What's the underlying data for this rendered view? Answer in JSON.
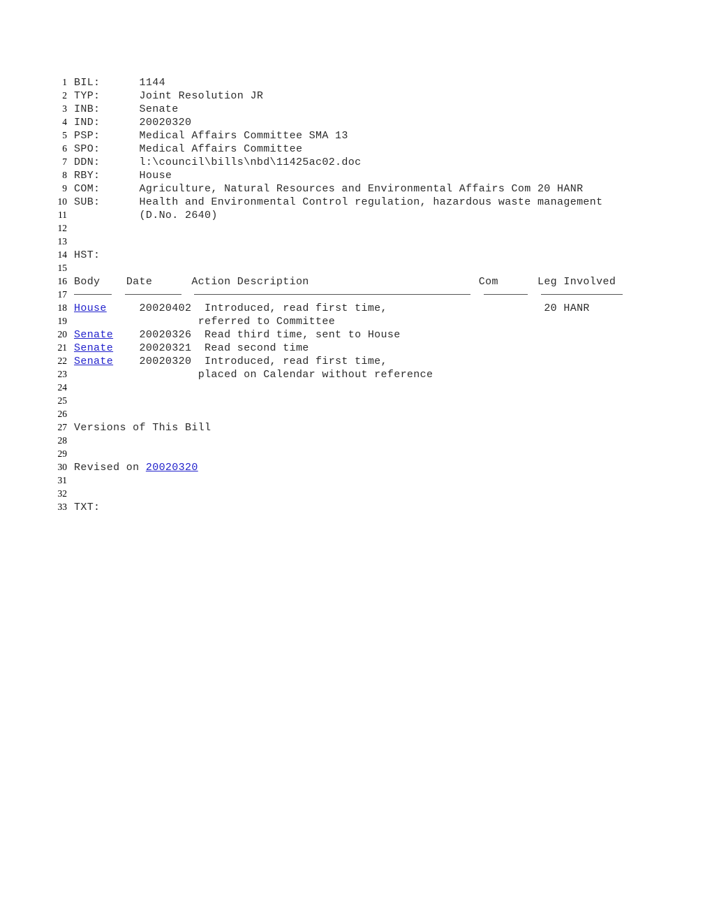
{
  "document": {
    "type": "legislative-bill-record",
    "background_color": "#ffffff",
    "text_color": "#2b2b2b",
    "link_color": "#2222cc",
    "total_lines": 33
  },
  "fields": {
    "bil": {
      "label": "BIL:",
      "value": "1144"
    },
    "typ": {
      "label": "TYP:",
      "value": "Joint Resolution JR"
    },
    "inb": {
      "label": "INB:",
      "value": "Senate"
    },
    "ind": {
      "label": "IND:",
      "value": "20020320"
    },
    "psp": {
      "label": "PSP:",
      "value": "Medical Affairs Committee SMA 13"
    },
    "spo": {
      "label": "SPO:",
      "value": "Medical Affairs Committee"
    },
    "ddn": {
      "label": "DDN:",
      "value": "l:\\council\\bills\\nbd\\11425ac02.doc"
    },
    "rby": {
      "label": "RBY:",
      "value": "House"
    },
    "com": {
      "label": "COM:",
      "value": "Agriculture, Natural Resources and Environmental Affairs Com 20 HANR"
    },
    "sub": {
      "label": "SUB:",
      "value": "Health and Environmental Control regulation, hazardous waste management"
    },
    "sub_cont": {
      "value": "(D.No. 2640)"
    },
    "hst": {
      "label": "HST:"
    },
    "txt": {
      "label": "TXT:"
    }
  },
  "history": {
    "headers": {
      "body": "Body",
      "date": "Date",
      "action": "Action Description",
      "com": "Com",
      "leg": "Leg Involved"
    },
    "rows": [
      {
        "body": "House",
        "body_is_link": true,
        "date": "20020402",
        "action": "Introduced, read first time,",
        "action_cont": "referred to Committee",
        "com": "20 HANR",
        "leg": ""
      },
      {
        "body": "Senate",
        "body_is_link": true,
        "date": "20020326",
        "action": "Read third time, sent to House",
        "action_cont": "",
        "com": "",
        "leg": ""
      },
      {
        "body": "Senate",
        "body_is_link": true,
        "date": "20020321",
        "action": "Read second time",
        "action_cont": "",
        "com": "",
        "leg": ""
      },
      {
        "body": "Senate",
        "body_is_link": true,
        "date": "20020320",
        "action": "Introduced, read first time,",
        "action_cont": "placed on Calendar without reference",
        "com": "",
        "leg": ""
      }
    ]
  },
  "versions": {
    "heading": "Versions of This Bill",
    "revised_prefix": "Revised on ",
    "revised_date": "20020320"
  },
  "line_numbers": {
    "n1": "1",
    "n2": "2",
    "n3": "3",
    "n4": "4",
    "n5": "5",
    "n6": "6",
    "n7": "7",
    "n8": "8",
    "n9": "9",
    "n10": "10",
    "n11": "11",
    "n12": "12",
    "n13": "13",
    "n14": "14",
    "n15": "15",
    "n16": "16",
    "n17": "17",
    "n18": "18",
    "n19": "19",
    "n20": "20",
    "n21": "21",
    "n22": "22",
    "n23": "23",
    "n24": "24",
    "n25": "25",
    "n26": "26",
    "n27": "27",
    "n28": "28",
    "n29": "29",
    "n30": "30",
    "n31": "31",
    "n32": "32",
    "n33": "33"
  }
}
